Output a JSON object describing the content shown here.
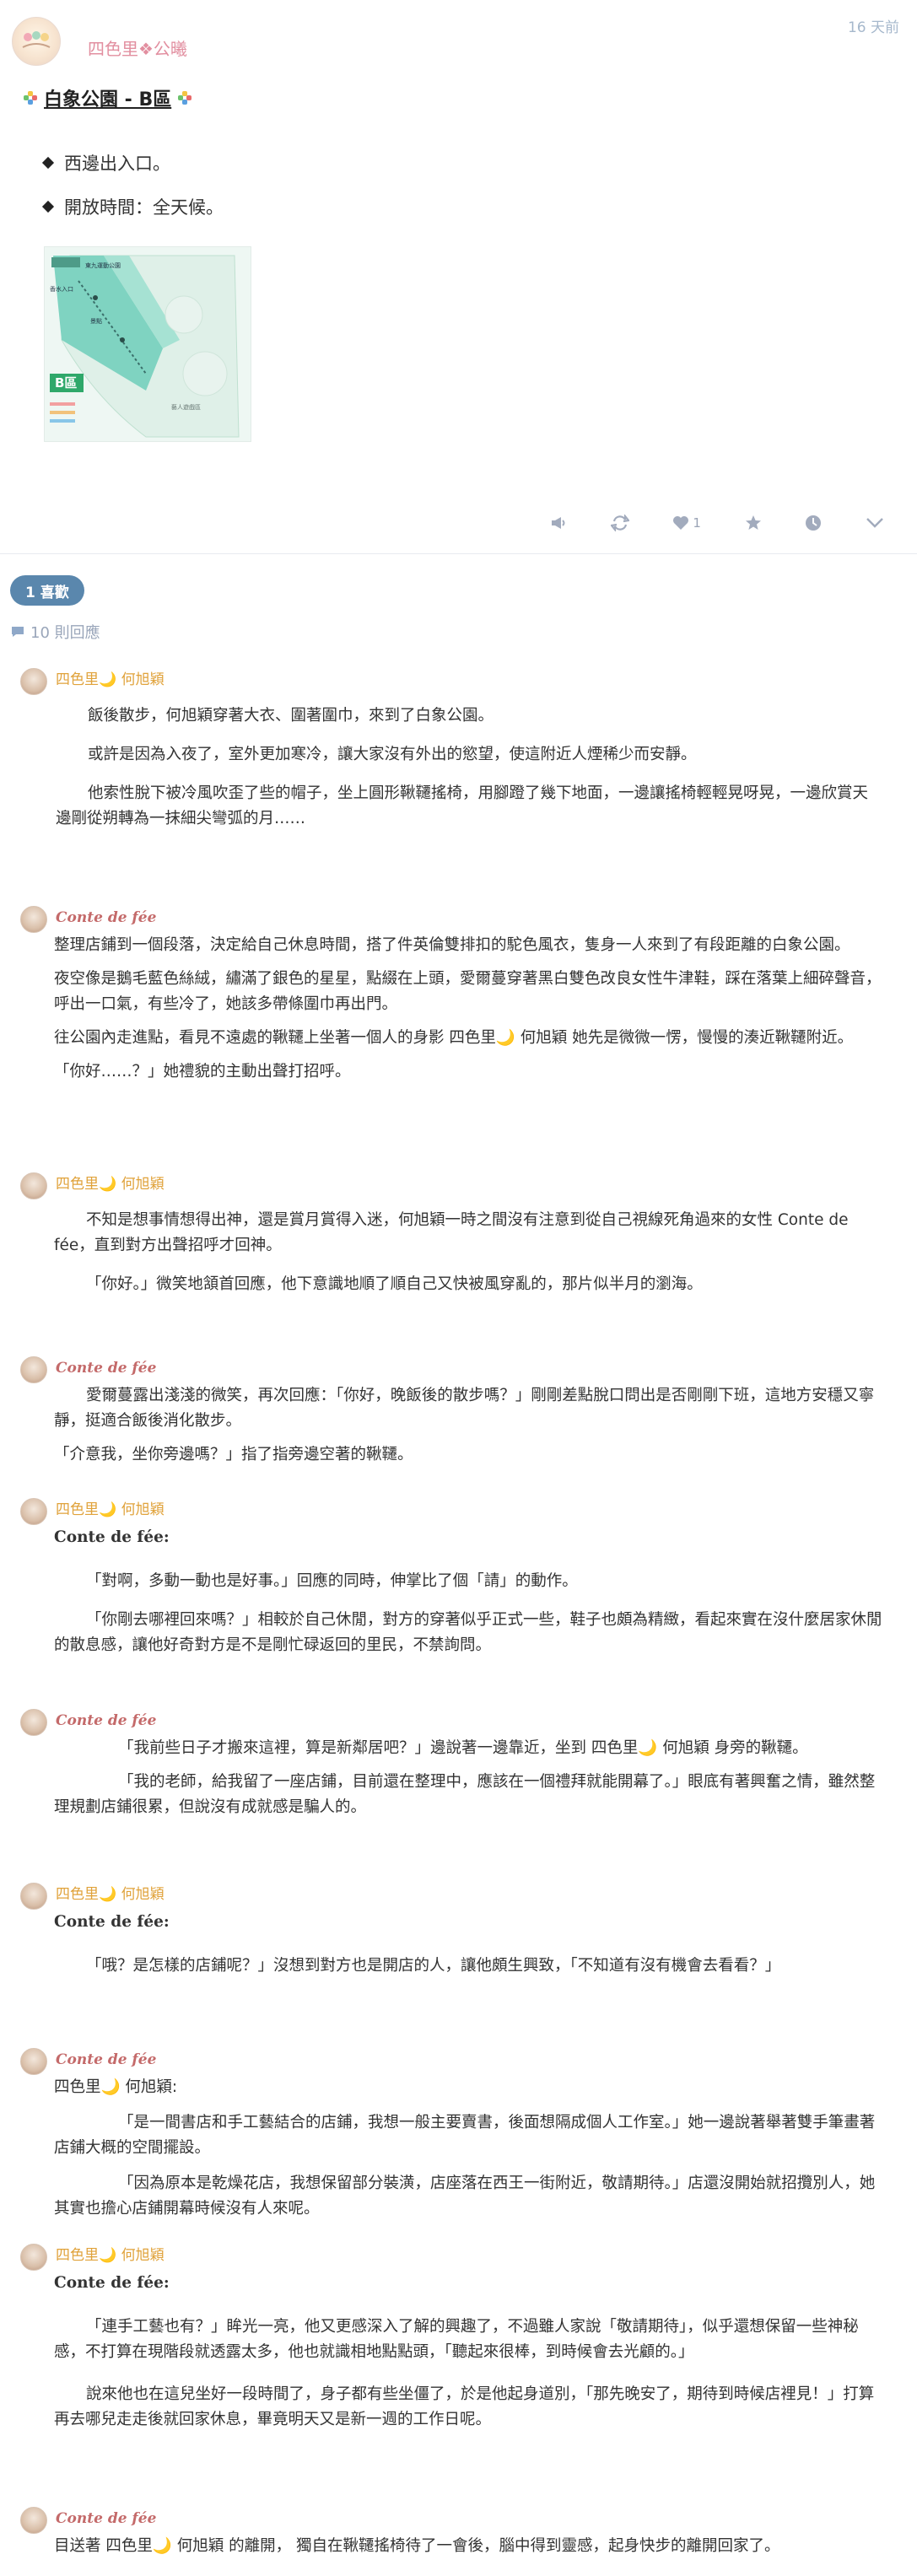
{
  "post": {
    "author": "四色里❖公曦",
    "time_ago": "16 天前",
    "title": "白象公園 - B區",
    "bullets": [
      "西邊出入口。",
      "開放時間：全天候。"
    ],
    "map": {
      "labels": [
        "東九運動公園",
        "香水入口",
        "景點",
        "B區",
        "藝人遊戲區"
      ],
      "badge": "B區"
    }
  },
  "actions": {
    "like_count": "1",
    "icons": [
      "megaphone-icon",
      "repost-icon",
      "heart-icon",
      "star-icon",
      "clock-icon",
      "chevron-down-icon"
    ]
  },
  "likes_label": "1 喜歡",
  "reply_count": "10 則回應",
  "replies": [
    {
      "author": "四色里🌙 何旭穎",
      "paras": [
        "飯後散步，何旭穎穿著大衣、圍著圍巾，來到了白象公園。",
        "或許是因為入夜了，室外更加寒冷，讓大家沒有外出的慾望，使這附近人煙稀少而安靜。",
        "他索性脫下被冷風吹歪了些的帽子，坐上圓形鞦韆搖椅，用腳蹬了幾下地面，一邊讓搖椅輕輕晃呀晃，一邊欣賞天邊剛從朔轉為一抹細尖彎弧的月……"
      ]
    },
    {
      "author": "Conte de fée",
      "paras": [
        "整理店鋪到一個段落，決定給自己休息時間，搭了件英倫雙排扣的駝色風衣，隻身一人來到了有段距離的白象公園。",
        "夜空像是鵝毛藍色絲絨，繡滿了銀色的星星，點綴在上頭，愛爾蔓穿著黑白雙色改良女性牛津鞋，踩在落葉上細碎聲音，呼出一口氣，有些冷了，她該多帶條圍巾再出門。",
        "往公園內走進點，看見不遠處的鞦韆上坐著一個人的身影 四色里🌙 何旭穎 她先是微微一愣，慢慢的湊近鞦韆附近。",
        "「你好……？」她禮貌的主動出聲打招呼。"
      ]
    },
    {
      "author": "四色里🌙 何旭穎",
      "paras": [
        "不知是想事情想得出神，還是賞月賞得入迷，何旭穎一時之間沒有注意到從自己視線死角過來的女性 Conte de fée，直到對方出聲招呼才回神。",
        "「你好。」微笑地頷首回應，他下意識地順了順自己又快被風穿亂的，那片似半月的瀏海。"
      ]
    },
    {
      "author": "Conte de fée",
      "paras": [
        "愛爾蔓露出淺淺的微笑，再次回應：「你好，晚飯後的散步嗎？」剛剛差點脫口問出是否剛剛下班，這地方安穩又寧靜，挺適合飯後消化散步。",
        "「介意我，坐你旁邊嗎？」指了指旁邊空著的鞦韆。"
      ]
    },
    {
      "author": "四色里🌙 何旭穎",
      "addressee": "Conte de fée:",
      "paras": [
        "「對啊，多動一動也是好事。」回應的同時，伸掌比了個「請」的動作。",
        "「你剛去哪裡回來嗎？」相較於自己休閒，對方的穿著似乎正式一些，鞋子也頗為精緻，看起來實在沒什麼居家休閒的散息感，讓他好奇對方是不是剛忙碌返回的里民，不禁詢問。"
      ]
    },
    {
      "author": "Conte de fée",
      "paras": [
        "「我前些日子才搬來這裡，算是新鄰居吧？」邊說著一邊靠近，坐到 四色里🌙 何旭穎 身旁的鞦韆。",
        "「我的老師，給我留了一座店鋪，目前還在整理中，應該在一個禮拜就能開幕了。」眼底有著興奮之情，雖然整理規劃店鋪很累，但說沒有成就感是騙人的。"
      ]
    },
    {
      "author": "四色里🌙 何旭穎",
      "addressee": "Conte de fée:",
      "paras": [
        "「哦？是怎樣的店鋪呢？」沒想到對方也是開店的人，讓他頗生興致，「不知道有沒有機會去看看？」"
      ]
    },
    {
      "author": "Conte de fée",
      "addressee": "四色里🌙 何旭穎:",
      "paras": [
        "「是一間書店和手工藝結合的店鋪，我想一般主要賣書，後面想隔成個人工作室。」她一邊說著舉著雙手筆畫著店鋪大概的空間擺設。",
        "「因為原本是乾燥花店，我想保留部分裝潢，店座落在西王一街附近，敬請期待。」店還沒開始就招攬別人，她其實也擔心店鋪開幕時候沒有人來呢。"
      ]
    },
    {
      "author": "四色里🌙 何旭穎",
      "addressee": "Conte de fée:",
      "paras": [
        "「連手工藝也有？」眸光一亮，他又更感深入了解的興趣了，不過雖人家說「敬請期待」，似乎還想保留一些神秘感，不打算在現階段就透露太多，他也就識相地點點頭，「聽起來很棒，到時候會去光顧的。」",
        "說來他也在這兒坐好一段時間了，身子都有些坐僵了，於是他起身道別，「那先晚安了，期待到時候店裡見！」打算再去哪兒走走後就回家休息，畢竟明天又是新一週的工作日呢。"
      ]
    },
    {
      "author": "Conte de fée",
      "paras": [
        "目送著 四色里🌙 何旭穎 的離開， 獨自在鞦韆搖椅待了一會後，腦中得到靈感，起身快步的離開回家了。"
      ]
    }
  ]
}
